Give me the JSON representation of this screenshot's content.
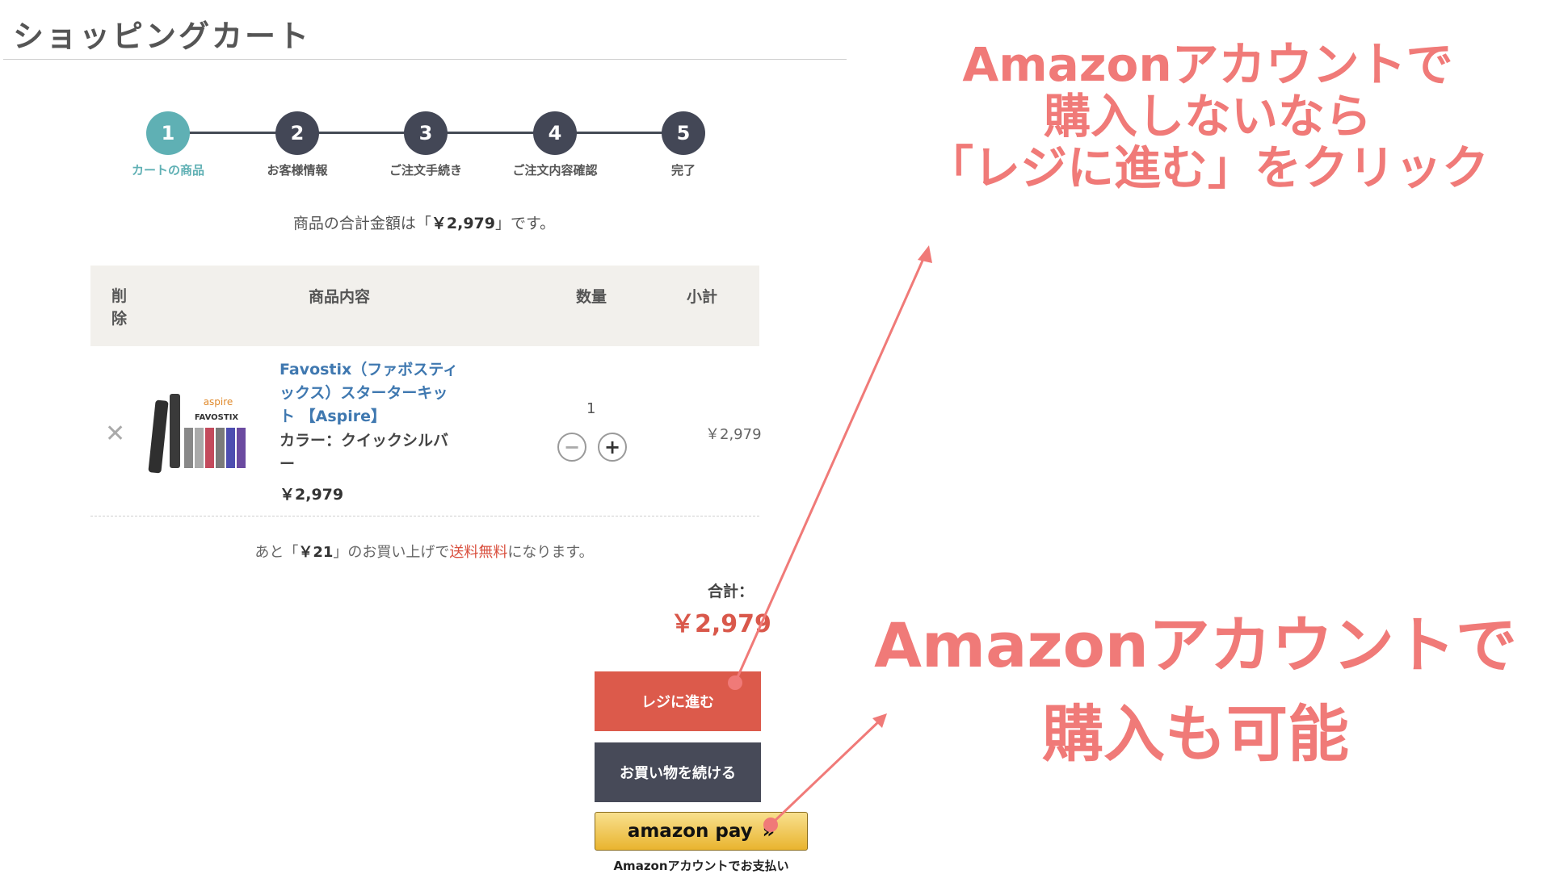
{
  "page": {
    "title": "ショッピングカート"
  },
  "steps": [
    {
      "number": "1",
      "label": "カートの商品"
    },
    {
      "number": "2",
      "label": "お客様情報"
    },
    {
      "number": "3",
      "label": "ご注文手続き"
    },
    {
      "number": "4",
      "label": "ご注文内容確認"
    },
    {
      "number": "5",
      "label": "完了"
    }
  ],
  "summary": {
    "prefix": "商品の合計金額は「",
    "amount": "￥2,979",
    "suffix": "」です。"
  },
  "table": {
    "headers": {
      "delete": "削除",
      "content": "商品内容",
      "quantity": "数量",
      "subtotal": "小計"
    }
  },
  "item": {
    "remove_icon": "✕",
    "image_brand": "aspire",
    "image_model": "FAVOSTIX",
    "name": "Favostix（ファボスティックス）スターターキット 【Aspire】",
    "option": "カラー：クイックシルバー",
    "price": "￥2,979",
    "quantity": "1",
    "minus": "−",
    "plus": "+",
    "subtotal": "￥2,979"
  },
  "shipping": {
    "prefix": "あと「",
    "amount": "￥21",
    "middle": "」のお買い上げで",
    "free": "送料無料",
    "suffix": "になります。"
  },
  "total": {
    "label": "合計：",
    "amount": "￥2,979"
  },
  "buttons": {
    "checkout": "レジに進む",
    "continue": "お買い物を続ける",
    "amazon_pay": "amazon pay",
    "amazon_chevron": "»",
    "amazon_caption": "Amazonアカウントでお支払い"
  },
  "annotations": {
    "top": [
      "Amazonアカウントで",
      "購入しないなら",
      "「レジに進む」をクリック"
    ],
    "bottom": [
      "Amazonアカウントで",
      "購入も可能"
    ]
  },
  "colors": {
    "accent_teal": "#5fb0b4",
    "step_dark": "#434756",
    "checkout_red": "#dc5a4b",
    "annotation_pink": "#f07a78",
    "amazon_gold": "#f0c14b"
  }
}
